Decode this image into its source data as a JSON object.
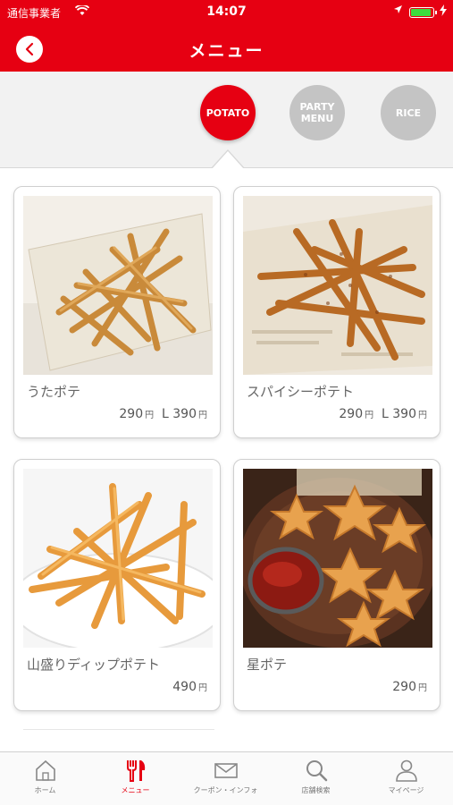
{
  "status_bar": {
    "carrier": "通信事業者",
    "time": "14:07"
  },
  "nav": {
    "title": "メニュー",
    "back_icon": "chevron-left-icon"
  },
  "categories": [
    {
      "line1": "POTATO",
      "line2": "",
      "active": true
    },
    {
      "line1": "PARTY",
      "line2": "MENU",
      "active": false
    },
    {
      "line1": "RICE",
      "line2": "",
      "active": false
    }
  ],
  "items": [
    {
      "name": "うたポテ",
      "price_regular": "290",
      "price_large": "L 390",
      "unit": "円"
    },
    {
      "name": "スパイシーポテト",
      "price_regular": "290",
      "price_large": "L 390",
      "unit": "円"
    },
    {
      "name": "山盛りディップポテト",
      "price_regular": "490",
      "unit": "円"
    },
    {
      "name": "星ポテ",
      "price_regular": "290",
      "unit": "円"
    }
  ],
  "tabs": [
    {
      "label": "ホーム",
      "icon": "home-icon"
    },
    {
      "label": "メニュー",
      "icon": "fork-knife-icon",
      "active": true
    },
    {
      "label": "クーポン・インフォ",
      "icon": "envelope-icon"
    },
    {
      "label": "店舗検索",
      "icon": "search-icon"
    },
    {
      "label": "マイページ",
      "icon": "person-icon"
    }
  ],
  "colors": {
    "brand": "#e60012",
    "inactive_category": "#c4c4c4"
  }
}
